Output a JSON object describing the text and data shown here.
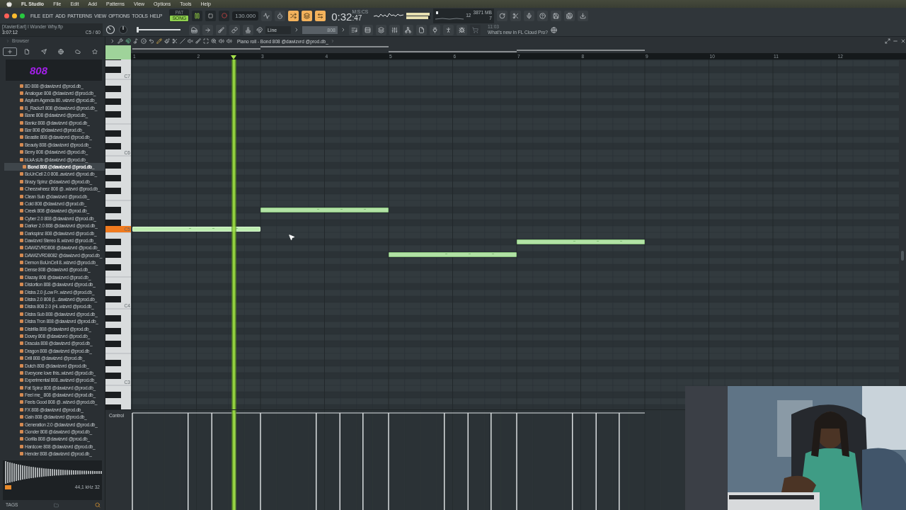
{
  "mac_menu": {
    "app": "FL Studio",
    "items": [
      "File",
      "Edit",
      "Add",
      "Patterns",
      "View",
      "Options",
      "Tools",
      "Help"
    ]
  },
  "toolbar": {
    "menu": [
      "FILE",
      "EDIT",
      "ADD",
      "PATTERNS",
      "VIEW",
      "OPTIONS",
      "TOOLS",
      "HELP"
    ],
    "pat_song": [
      {
        "label": "PAT",
        "selected": false
      },
      {
        "label": "SONG",
        "selected": true
      }
    ],
    "tempo": "130.000",
    "time": "0:32",
    "time_small": ":47",
    "time_unit": "M:S:CS",
    "output_meter": [
      {
        "level": 0.97
      },
      {
        "level": 0.9
      }
    ],
    "cpu": {
      "polyphony": "12",
      "memory": "3871 MB",
      "voices": "7"
    },
    "project": {
      "name": "[XavierEarl] I Wonder Why.flp",
      "time": "3:07:12",
      "note": "C5 / 60"
    },
    "master_slider": {
      "level": 0
    },
    "snap": "Line",
    "pattern": "808",
    "hint_time": "11:03",
    "hint_text": "What's new in FL Cloud Pro?"
  },
  "browser": {
    "title": "Browser",
    "tabs": [
      {
        "selected": true
      },
      {
        "selected": false
      },
      {
        "selected": false
      },
      {
        "selected": false
      },
      {
        "selected": false
      },
      {
        "selected": false
      }
    ],
    "folder": "808",
    "items": [
      {
        "label": "8D 808 @dawizvrd @prod.db_",
        "selected": false
      },
      {
        "label": "Analogue 808 @dawizvrd @prod.db_",
        "selected": false
      },
      {
        "label": "Asylum Agenda 80..wizvrd @prod.db_",
        "selected": false
      },
      {
        "label": "B_Rackz!! 808 @dawizvrd @prod.db_",
        "selected": false
      },
      {
        "label": "Bane 808 @dawizvrd @prod.db_",
        "selected": false
      },
      {
        "label": "Bankz 808 @dawizvrd @prod.db_",
        "selected": false
      },
      {
        "label": "Bar 808 @dawizvrd @prod.db_",
        "selected": false
      },
      {
        "label": "Beastie 808 @dawizvrd @prod.db_",
        "selected": false
      },
      {
        "label": "Beauty 808 @dawizvrd @prod.db_",
        "selected": false
      },
      {
        "label": "Berry 808 @dawizvrd @prod.db_",
        "selected": false
      },
      {
        "label": "bLkA sUb @dawizvrd @prod.db_",
        "selected": false
      },
      {
        "label": "Bond 808 @dawizvrd @prod.db_",
        "selected": true
      },
      {
        "label": "BoUnCell 2.0 808..awizvrd @prod.db_",
        "selected": false
      },
      {
        "label": "Brazy Spinz @dawizvrd @prod.db_",
        "selected": false
      },
      {
        "label": "Cheezwheez 808 @..wizvrd @prod.db_",
        "selected": false
      },
      {
        "label": "Clean Sub @dawizvrd @prod.db_",
        "selected": false
      },
      {
        "label": "Cold 808 @dawizvrd @prod.db_",
        "selected": false
      },
      {
        "label": "Creek 808 @dawizvrd @prod.db_",
        "selected": false
      },
      {
        "label": "Cyber 2.0 808 @dawizvrd @prod.db_",
        "selected": false
      },
      {
        "label": "Darker 2.0 808 @dawizvrd @prod.db_",
        "selected": false
      },
      {
        "label": "Darkspinz 808 @dawizvrd @prod.db_",
        "selected": false
      },
      {
        "label": "Dawizvrd Stereo 8..wizvrd @prod.db_",
        "selected": false
      },
      {
        "label": "DAWIZVRD808 @dawizvrd @prod.db_",
        "selected": false
      },
      {
        "label": "DAWIZVRD8082 @dawizvrd @prod.db_",
        "selected": false
      },
      {
        "label": "Demon BoUnCell 8..wizvrd @prod.db_",
        "selected": false
      },
      {
        "label": "Dense 808 @dawizvrd @prod.db_",
        "selected": false
      },
      {
        "label": "Diazay 808 @dawizvrd @prod.db_",
        "selected": false
      },
      {
        "label": "Distortion 808 @dawizvrd @prod.db_",
        "selected": false
      },
      {
        "label": "Distra 2.0 (Low Fr..wizvrd @prod.db_",
        "selected": false
      },
      {
        "label": "Distra 2.0 808 (L..dawizvrd @prod.db_",
        "selected": false
      },
      {
        "label": "Distra 808 2.0 (Hi..wizvrd @prod.db_",
        "selected": false
      },
      {
        "label": "Distra Sub 808 @dawizvrd @prod.db_",
        "selected": false
      },
      {
        "label": "Distra Tron 808 @dawizvrd @prod.db_",
        "selected": false
      },
      {
        "label": "Distrilla 808 @dawizvrd @prod.db_",
        "selected": false
      },
      {
        "label": "Dovey 808 @dawizvrd @prod.db_",
        "selected": false
      },
      {
        "label": "Dracula 808 @dawizvrd @prod.db_",
        "selected": false
      },
      {
        "label": "Dragon 808 @dawizvrd @prod.db_",
        "selected": false
      },
      {
        "label": "Drill 808 @dawizvrd @prod.db_",
        "selected": false
      },
      {
        "label": "Dutch 808 @dawizvrd @prod.db_",
        "selected": false
      },
      {
        "label": "Everyone love this..wizvrd @prod.db_",
        "selected": false
      },
      {
        "label": "Experimental 808..awizvrd @prod.db_",
        "selected": false
      },
      {
        "label": "Fat Spinz 808 @dawizvrd @prod.db_",
        "selected": false
      },
      {
        "label": "Feel me_ 808 @dawizvrd @prod.db_",
        "selected": false
      },
      {
        "label": "Feels Good 808 @..wizvrd @prod.db_",
        "selected": false
      },
      {
        "label": "FX 808 @dawizvrd @prod.db_",
        "selected": false
      },
      {
        "label": "Gain 808 @dawizvrd @prod.db_",
        "selected": false
      },
      {
        "label": "Generation 2.0 @dawizvrd @prod.db_",
        "selected": false
      },
      {
        "label": "Gonder 808 @dawizvrd @prod.db_",
        "selected": false
      },
      {
        "label": "Gorilla 808 @dawizvrd @prod.db_",
        "selected": false
      },
      {
        "label": "Hardcore 808 @dawizvrd @prod.db_",
        "selected": false
      },
      {
        "label": "Hender 808 @dawizvrd @prod.db_",
        "selected": false
      }
    ],
    "sample_info": "44,1 kHz 32",
    "tags": "TAGS"
  },
  "piano_roll": {
    "title": "Piano roll - Bond 808 @dawizvrd @prod.db_",
    "bars": [
      "1",
      "2",
      "3",
      "4",
      "5",
      "6",
      "7",
      "8",
      "9",
      "10",
      "11",
      "12"
    ],
    "octaves": [
      "C7",
      "C6",
      "C5",
      "C4",
      "C3"
    ],
    "playhead": {
      "level": 0.1335
    },
    "notes": [
      {
        "playing": true
      },
      {
        "playing": false
      },
      {
        "playing": false
      },
      {
        "playing": false
      }
    ],
    "control_lane": "Control"
  }
}
